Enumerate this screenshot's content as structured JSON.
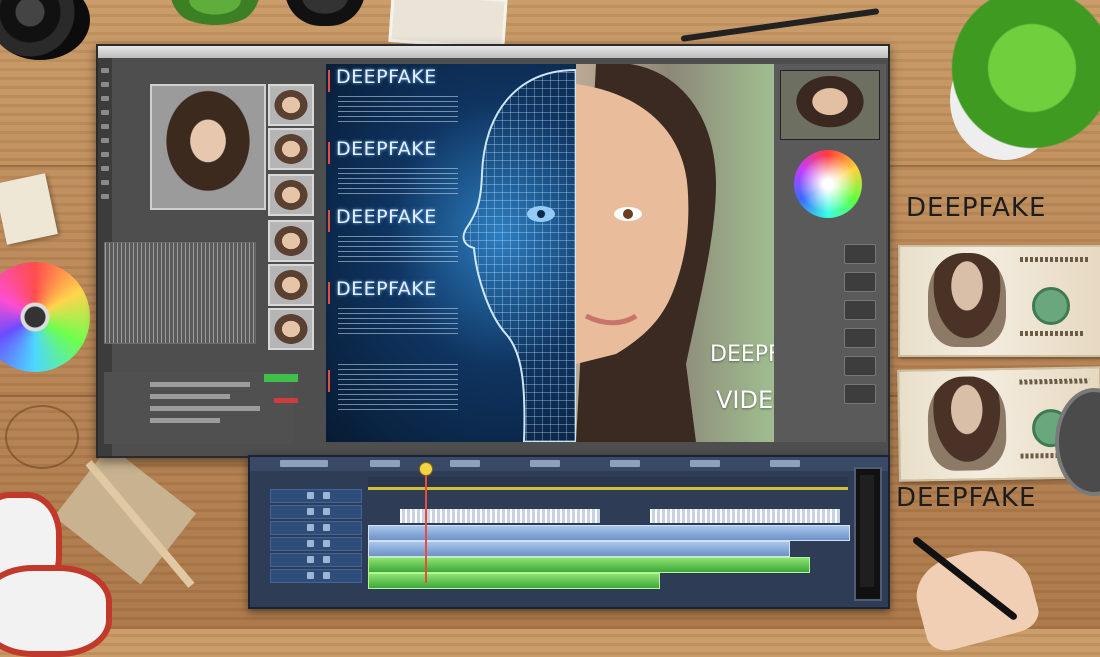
{
  "overlay": {
    "deepfake_1": "DEEPFAKE",
    "deepfake_2": "DEEPFAKE",
    "deepfake_3": "DEEPFAKE",
    "deepfake_4": "DEEPFAKE",
    "photo_title": "DEEPFAKE",
    "photo_subtitle": "VIDEO"
  },
  "desk": {
    "right_label_top": "DEEPFAKE",
    "right_label_bottom": "DEEPFAKE"
  },
  "colors": {
    "timeline_bg": "#2e3d55",
    "clip_blue": "#6d92c7",
    "clip_green": "#3ca83a",
    "playhead": "#e74c3c",
    "mesh_blue": "#2d7ec0"
  },
  "icons": [
    "color-wheel-icon",
    "track-visibility-icon",
    "track-lock-icon"
  ]
}
